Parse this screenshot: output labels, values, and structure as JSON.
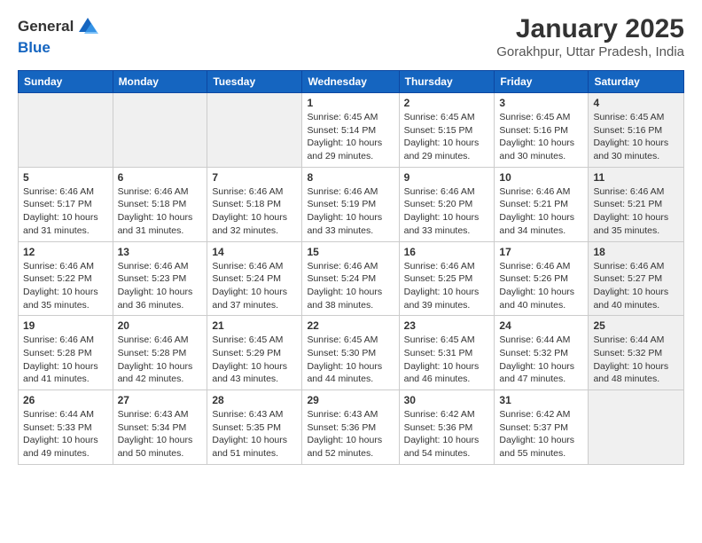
{
  "header": {
    "logo": {
      "line1": "General",
      "line2": "Blue"
    },
    "title": "January 2025",
    "subtitle": "Gorakhpur, Uttar Pradesh, India"
  },
  "days_of_week": [
    "Sunday",
    "Monday",
    "Tuesday",
    "Wednesday",
    "Thursday",
    "Friday",
    "Saturday"
  ],
  "weeks": [
    [
      {
        "num": "",
        "info": "",
        "shaded": true
      },
      {
        "num": "",
        "info": "",
        "shaded": true
      },
      {
        "num": "",
        "info": "",
        "shaded": true
      },
      {
        "num": "1",
        "info": "Sunrise: 6:45 AM\nSunset: 5:14 PM\nDaylight: 10 hours\nand 29 minutes.",
        "shaded": false
      },
      {
        "num": "2",
        "info": "Sunrise: 6:45 AM\nSunset: 5:15 PM\nDaylight: 10 hours\nand 29 minutes.",
        "shaded": false
      },
      {
        "num": "3",
        "info": "Sunrise: 6:45 AM\nSunset: 5:16 PM\nDaylight: 10 hours\nand 30 minutes.",
        "shaded": false
      },
      {
        "num": "4",
        "info": "Sunrise: 6:45 AM\nSunset: 5:16 PM\nDaylight: 10 hours\nand 30 minutes.",
        "shaded": true
      }
    ],
    [
      {
        "num": "5",
        "info": "Sunrise: 6:46 AM\nSunset: 5:17 PM\nDaylight: 10 hours\nand 31 minutes.",
        "shaded": false
      },
      {
        "num": "6",
        "info": "Sunrise: 6:46 AM\nSunset: 5:18 PM\nDaylight: 10 hours\nand 31 minutes.",
        "shaded": false
      },
      {
        "num": "7",
        "info": "Sunrise: 6:46 AM\nSunset: 5:18 PM\nDaylight: 10 hours\nand 32 minutes.",
        "shaded": false
      },
      {
        "num": "8",
        "info": "Sunrise: 6:46 AM\nSunset: 5:19 PM\nDaylight: 10 hours\nand 33 minutes.",
        "shaded": false
      },
      {
        "num": "9",
        "info": "Sunrise: 6:46 AM\nSunset: 5:20 PM\nDaylight: 10 hours\nand 33 minutes.",
        "shaded": false
      },
      {
        "num": "10",
        "info": "Sunrise: 6:46 AM\nSunset: 5:21 PM\nDaylight: 10 hours\nand 34 minutes.",
        "shaded": false
      },
      {
        "num": "11",
        "info": "Sunrise: 6:46 AM\nSunset: 5:21 PM\nDaylight: 10 hours\nand 35 minutes.",
        "shaded": true
      }
    ],
    [
      {
        "num": "12",
        "info": "Sunrise: 6:46 AM\nSunset: 5:22 PM\nDaylight: 10 hours\nand 35 minutes.",
        "shaded": false
      },
      {
        "num": "13",
        "info": "Sunrise: 6:46 AM\nSunset: 5:23 PM\nDaylight: 10 hours\nand 36 minutes.",
        "shaded": false
      },
      {
        "num": "14",
        "info": "Sunrise: 6:46 AM\nSunset: 5:24 PM\nDaylight: 10 hours\nand 37 minutes.",
        "shaded": false
      },
      {
        "num": "15",
        "info": "Sunrise: 6:46 AM\nSunset: 5:24 PM\nDaylight: 10 hours\nand 38 minutes.",
        "shaded": false
      },
      {
        "num": "16",
        "info": "Sunrise: 6:46 AM\nSunset: 5:25 PM\nDaylight: 10 hours\nand 39 minutes.",
        "shaded": false
      },
      {
        "num": "17",
        "info": "Sunrise: 6:46 AM\nSunset: 5:26 PM\nDaylight: 10 hours\nand 40 minutes.",
        "shaded": false
      },
      {
        "num": "18",
        "info": "Sunrise: 6:46 AM\nSunset: 5:27 PM\nDaylight: 10 hours\nand 40 minutes.",
        "shaded": true
      }
    ],
    [
      {
        "num": "19",
        "info": "Sunrise: 6:46 AM\nSunset: 5:28 PM\nDaylight: 10 hours\nand 41 minutes.",
        "shaded": false
      },
      {
        "num": "20",
        "info": "Sunrise: 6:46 AM\nSunset: 5:28 PM\nDaylight: 10 hours\nand 42 minutes.",
        "shaded": false
      },
      {
        "num": "21",
        "info": "Sunrise: 6:45 AM\nSunset: 5:29 PM\nDaylight: 10 hours\nand 43 minutes.",
        "shaded": false
      },
      {
        "num": "22",
        "info": "Sunrise: 6:45 AM\nSunset: 5:30 PM\nDaylight: 10 hours\nand 44 minutes.",
        "shaded": false
      },
      {
        "num": "23",
        "info": "Sunrise: 6:45 AM\nSunset: 5:31 PM\nDaylight: 10 hours\nand 46 minutes.",
        "shaded": false
      },
      {
        "num": "24",
        "info": "Sunrise: 6:44 AM\nSunset: 5:32 PM\nDaylight: 10 hours\nand 47 minutes.",
        "shaded": false
      },
      {
        "num": "25",
        "info": "Sunrise: 6:44 AM\nSunset: 5:32 PM\nDaylight: 10 hours\nand 48 minutes.",
        "shaded": true
      }
    ],
    [
      {
        "num": "26",
        "info": "Sunrise: 6:44 AM\nSunset: 5:33 PM\nDaylight: 10 hours\nand 49 minutes.",
        "shaded": false
      },
      {
        "num": "27",
        "info": "Sunrise: 6:43 AM\nSunset: 5:34 PM\nDaylight: 10 hours\nand 50 minutes.",
        "shaded": false
      },
      {
        "num": "28",
        "info": "Sunrise: 6:43 AM\nSunset: 5:35 PM\nDaylight: 10 hours\nand 51 minutes.",
        "shaded": false
      },
      {
        "num": "29",
        "info": "Sunrise: 6:43 AM\nSunset: 5:36 PM\nDaylight: 10 hours\nand 52 minutes.",
        "shaded": false
      },
      {
        "num": "30",
        "info": "Sunrise: 6:42 AM\nSunset: 5:36 PM\nDaylight: 10 hours\nand 54 minutes.",
        "shaded": false
      },
      {
        "num": "31",
        "info": "Sunrise: 6:42 AM\nSunset: 5:37 PM\nDaylight: 10 hours\nand 55 minutes.",
        "shaded": false
      },
      {
        "num": "",
        "info": "",
        "shaded": true
      }
    ]
  ]
}
